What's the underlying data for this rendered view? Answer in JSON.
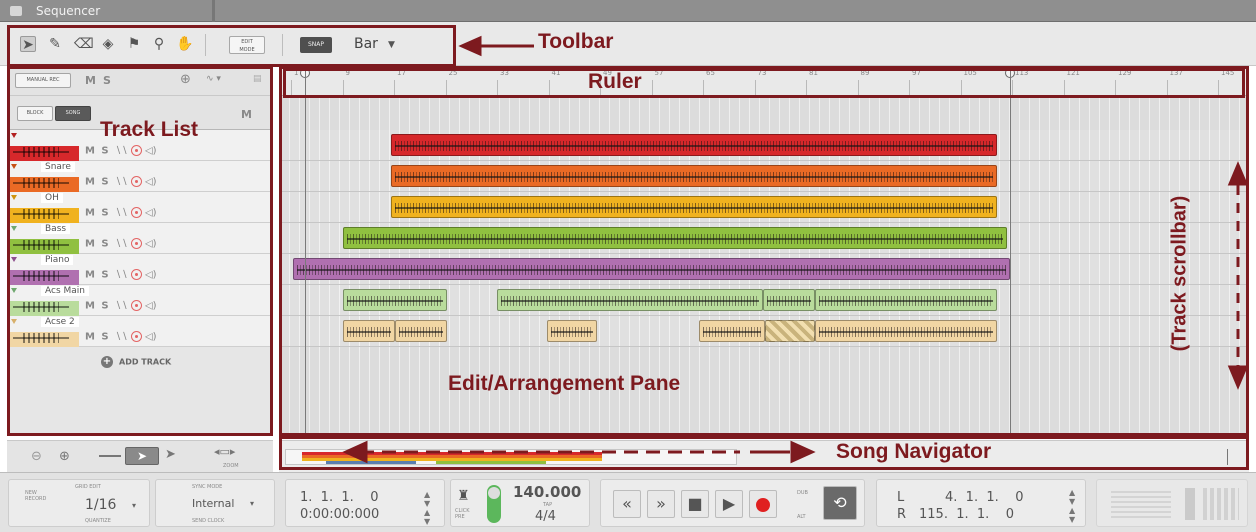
{
  "window": {
    "title": "Sequencer"
  },
  "toolbar": {
    "tools": [
      "select-icon",
      "pencil-icon",
      "eraser-icon",
      "paint-icon",
      "split-icon",
      "zoom-icon",
      "hand-icon"
    ],
    "edit_mode_label": "EDIT\nMODE",
    "snap_label": "SNAP",
    "snap_value": "Bar"
  },
  "tracklist": {
    "manual_rec_label": "MANUAL REC",
    "block_label": "BLOCK",
    "song_label": "SONG",
    "mute_label": "M",
    "solo_label": "S",
    "add_track_label": "ADD TRACK",
    "tracks": [
      {
        "name": "",
        "color": "#d7282b"
      },
      {
        "name": "Snare",
        "color": "#ea6a25"
      },
      {
        "name": "OH",
        "color": "#f0b21f"
      },
      {
        "name": "Bass",
        "color": "#90c040"
      },
      {
        "name": "Piano",
        "color": "#b070b0"
      },
      {
        "name": "Acs Main",
        "color": "#b9dc9c"
      },
      {
        "name": "Acse 2",
        "color": "#f1d6a4"
      }
    ]
  },
  "ruler": {
    "numbers": [
      "1",
      "9",
      "17",
      "25",
      "33",
      "41",
      "49",
      "57",
      "65",
      "73",
      "81",
      "89",
      "97",
      "105",
      "113",
      "121",
      "129",
      "137",
      "145"
    ]
  },
  "annotations": {
    "toolbar": "Toolbar",
    "ruler": "Ruler",
    "track_list": "Track List",
    "edit_pane": "Edit/Arrangement Pane",
    "song_navigator": "Song Navigator",
    "track_scrollbar": "(Track scrollbar)"
  },
  "zoom": {
    "label": "ZOOM"
  },
  "transport": {
    "quantize_label_top": "GRID EDIT",
    "quantize_label_side": "NEW\nRECORD",
    "quantize_value": "1/16",
    "quantize_sub": "QUANTIZE",
    "sync_label": "SYNC MODE",
    "sync_value": "Internal",
    "sync_sub": "SEND CLOCK",
    "position_bars": "1.  1.  1.    0",
    "position_time": "0:00:00:000",
    "click_label": "CLICK\nPRE",
    "tempo": "140.000",
    "tap_label": "TAP",
    "signature": "4/4",
    "dub_label": "DUB",
    "alt_label": "ALT",
    "loop_left": "4.  1.  1.    0",
    "loop_right": "115.  1.  1.    0",
    "L": "L",
    "R": "R"
  }
}
